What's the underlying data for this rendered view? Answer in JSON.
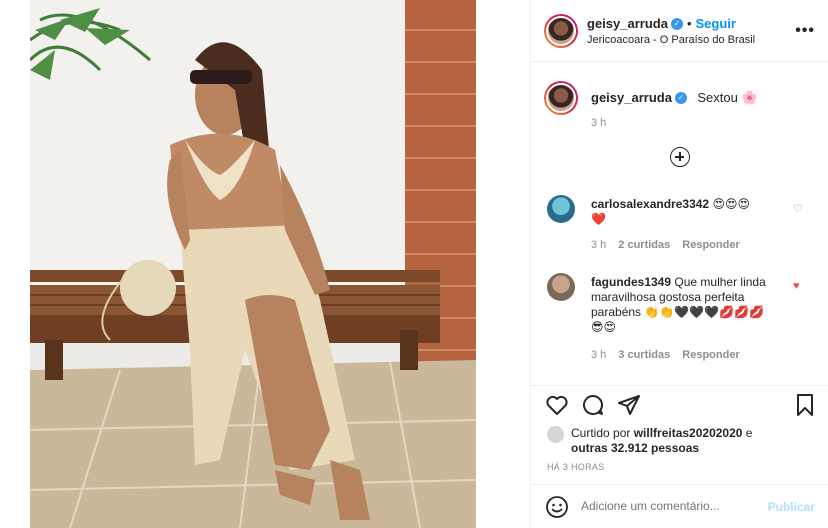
{
  "post": {
    "author": "geisy_arruda",
    "follow_label": "Seguir",
    "location": "Jericoacoara - O Paraíso do Brasil",
    "more_label": "•••"
  },
  "caption": {
    "username": "geisy_arruda",
    "text": "Sextou 🌸",
    "time": "3 h"
  },
  "comments": [
    {
      "username": "carlosalexandre3342",
      "text_line1": "😍😍😍",
      "text_line2": "❤️",
      "time": "3 h",
      "likes": "2 curtidas",
      "reply": "Responder",
      "liked": false
    },
    {
      "username": "fagundes1349",
      "text_line1": "Que mulher linda",
      "text_line2": "maravilhosa gostosa perfeita",
      "text_line3": "parabéns 👏👏🖤🖤🖤💋💋💋",
      "text_line4": "😎😍",
      "time": "3 h",
      "likes": "3 curtidas",
      "reply": "Responder",
      "liked": true
    }
  ],
  "likes": {
    "prefix": "Curtido por ",
    "user": "willfreitas20202020",
    "mid": " e",
    "others": "outras 32.912 pessoas"
  },
  "timestamp": "HÁ 3 HORAS",
  "comment_box": {
    "placeholder": "Adicione um comentário...",
    "publish": "Publicar"
  },
  "colors": {
    "link_blue": "#0095f6",
    "publish_disabled": "#b2dffc",
    "like_red": "#ed4956",
    "verified_blue": "#3897f0"
  }
}
